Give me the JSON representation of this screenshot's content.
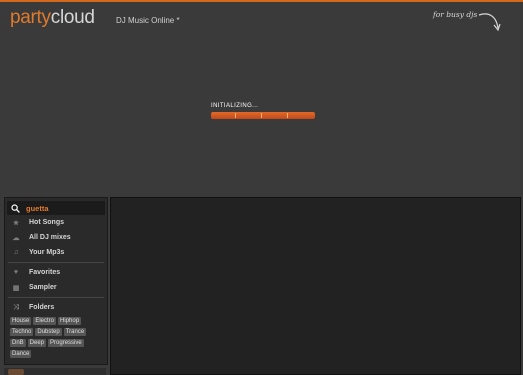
{
  "header": {
    "logo_party": "party",
    "logo_cloud": "cloud",
    "subtitle": "DJ Music Online *",
    "tagline": "for busy djs"
  },
  "loader": {
    "label": "INITIALIZING...",
    "progress_fraction": 1.0
  },
  "sidebar": {
    "search": {
      "value": "guetta",
      "icon": "search-icon"
    },
    "items": [
      {
        "label": "Hot Songs",
        "icon": "star-icon"
      },
      {
        "label": "All DJ mixes",
        "icon": "cloud-icon"
      },
      {
        "label": "Your Mp3s",
        "icon": "music-note-icon"
      },
      {
        "label": "Favorites",
        "icon": "heart-icon"
      },
      {
        "label": "Sampler",
        "icon": "grid-icon"
      },
      {
        "label": "Folders",
        "icon": "shuffle-icon"
      }
    ],
    "tags": [
      "House",
      "Electro",
      "Hiphop",
      "Techno",
      "Dubstep",
      "Trance",
      "DnB",
      "Deep",
      "Progressive",
      "Dance"
    ]
  },
  "colors": {
    "accent": "#e07a2c",
    "background": "#3a3a3a",
    "panel": "#2a2a2a",
    "main_panel": "#222222"
  }
}
